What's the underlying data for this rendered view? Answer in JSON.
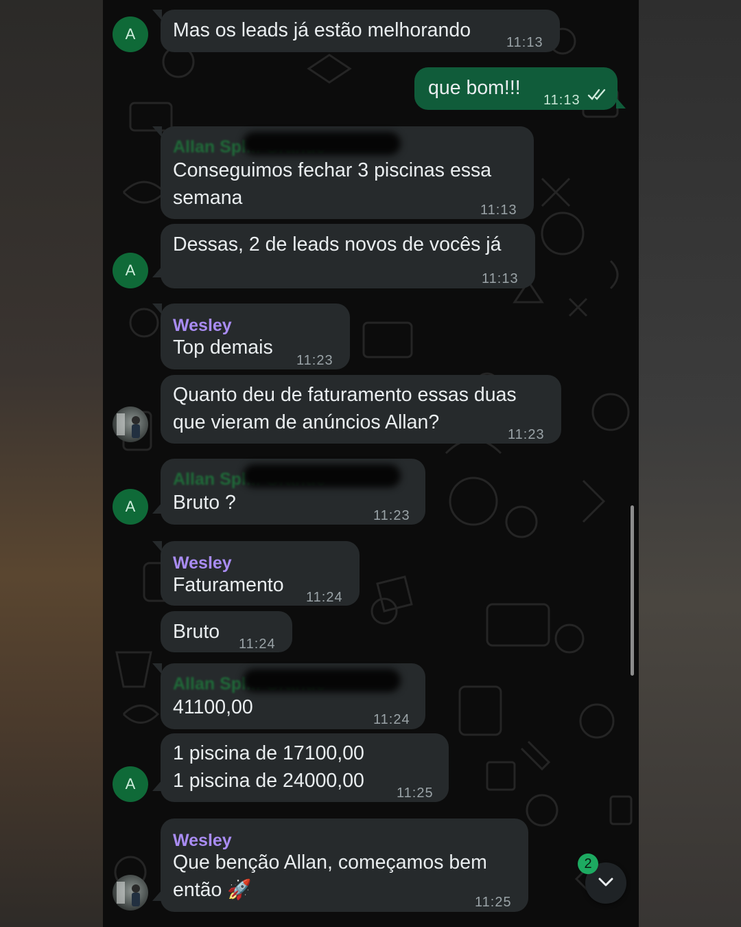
{
  "conversation": {
    "messages": [
      {
        "id": "m1",
        "direction": "in",
        "avatar_letter": "A",
        "text": "Mas os leads já estão melhorando",
        "time": "11:13"
      },
      {
        "id": "m2",
        "direction": "out",
        "text": "que bom!!!",
        "time": "11:13",
        "status_icon": "double-check-icon"
      },
      {
        "id": "m3",
        "direction": "in",
        "sender_redacted": "Allan Spl... Grande",
        "lines": [
          "Conseguimos fechar 3 piscinas essa",
          "semana"
        ],
        "time": "11:13"
      },
      {
        "id": "m4",
        "direction": "in",
        "avatar_letter": "A",
        "text": "Dessas, 2 de leads novos de vocês já",
        "time": "11:13"
      },
      {
        "id": "m5",
        "direction": "in",
        "sender": "Wesley",
        "text": "Top demais",
        "time": "11:23"
      },
      {
        "id": "m6",
        "direction": "in",
        "avatar": "photo",
        "lines": [
          "Quanto deu de faturamento essas duas",
          "que vieram de anúncios Allan?"
        ],
        "time": "11:23"
      },
      {
        "id": "m7",
        "direction": "in",
        "avatar_letter": "A",
        "sender_redacted": "Allan Spl... Grande",
        "text": "Bruto ?",
        "time": "11:23"
      },
      {
        "id": "m8",
        "direction": "in",
        "sender": "Wesley",
        "text": "Faturamento",
        "time": "11:24"
      },
      {
        "id": "m9",
        "direction": "in",
        "text": "Bruto",
        "time": "11:24"
      },
      {
        "id": "m10",
        "direction": "in",
        "sender_redacted": "Allan Spl... Grande",
        "text": "41100,00",
        "time": "11:24"
      },
      {
        "id": "m11",
        "direction": "in",
        "avatar_letter": "A",
        "lines": [
          "1 piscina de 17100,00",
          "1 piscina de 24000,00"
        ],
        "time": "11:25"
      },
      {
        "id": "m12",
        "direction": "in",
        "sender": "Wesley",
        "avatar": "photo",
        "lines": [
          "Que benção Allan, começamos bem",
          "então 🚀"
        ],
        "time": "11:25"
      }
    ]
  },
  "scroll_button": {
    "unread_count": "2",
    "icon": "chevron-down-icon"
  },
  "colors": {
    "chat_background": "#0c0c0c",
    "incoming_bubble": "#262a2c",
    "outgoing_bubble": "#105c3a",
    "sender_name": "#a98cf3",
    "avatar_green": "#0f6a38",
    "badge_green": "#1daa61"
  }
}
